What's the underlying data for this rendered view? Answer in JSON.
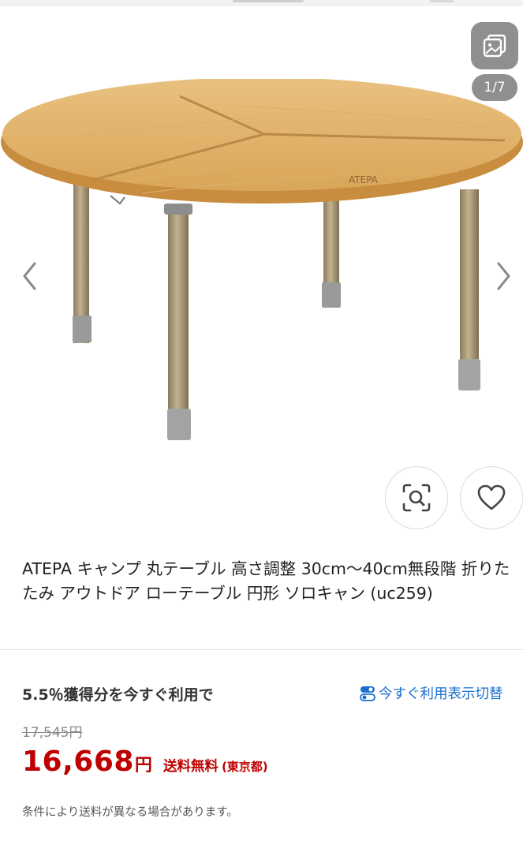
{
  "gallery": {
    "counter": "1/7",
    "gallery_icon": "gallery-icon",
    "prev_icon": "chevron-left-icon",
    "next_icon": "chevron-right-icon",
    "visual_search_icon": "visual-search-icon",
    "favorite_icon": "heart-icon",
    "image_logo": "ATEPA"
  },
  "product": {
    "title": "ATEPA キャンプ 丸テーブル 高さ調整 30cm～40cm無段階 折りたたみ アウトドア ローテーブル 円形 ソロキャン (uc259)"
  },
  "points": {
    "text": "5.5％獲得分を今すぐ利用で",
    "link_label": "今すぐ利用表示切替",
    "link_icon": "toggle-icon"
  },
  "pricing": {
    "original_price": "17,545円",
    "price": "16,668",
    "price_unit": "円",
    "shipping": "送料無料",
    "shipping_area": "(東京都)",
    "shipping_note": "条件により送料が異なる場合があります。"
  },
  "colors": {
    "price_red": "#bf0000",
    "link_blue": "#1a6fd1",
    "overlay_gray": "#8f8f8f"
  }
}
